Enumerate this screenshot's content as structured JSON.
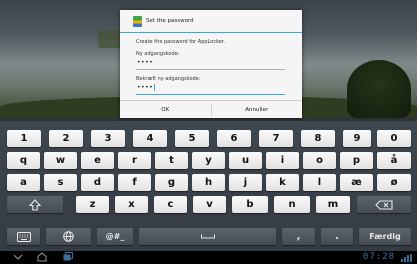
{
  "dialog": {
    "title": "Set the password",
    "message": "Create the password for AppLocker.",
    "new_password_label": "Ny adgangskode:",
    "new_password_value": "••••",
    "confirm_password_label": "Bekræft ny adgangskode:",
    "confirm_password_value": "••••",
    "ok_label": "OK",
    "cancel_label": "Annuller"
  },
  "keyboard": {
    "row1": [
      "1",
      "2",
      "3",
      "4",
      "5",
      "6",
      "7",
      "8",
      "9",
      "0"
    ],
    "row2": [
      "q",
      "w",
      "e",
      "r",
      "t",
      "y",
      "u",
      "i",
      "o",
      "p",
      "å"
    ],
    "row3": [
      "a",
      "s",
      "d",
      "f",
      "g",
      "h",
      "j",
      "k",
      "l",
      "æ",
      "ø"
    ],
    "row4": [
      "z",
      "x",
      "c",
      "v",
      "b",
      "n",
      "m"
    ],
    "symbols_label": "@#_",
    "done_label": "Færdig",
    "comma": ",",
    "period": "."
  },
  "statusbar": {
    "clock": "07:28"
  },
  "colors": {
    "accent": "#39a7d9",
    "clock": "#3b6f9d"
  },
  "icons": [
    "app-locker-icon",
    "shift-icon",
    "backspace-icon",
    "keyboard-settings-icon",
    "globe-icon",
    "space-icon",
    "back-nav-icon",
    "home-nav-icon",
    "recent-apps-icon",
    "signal-icon"
  ]
}
